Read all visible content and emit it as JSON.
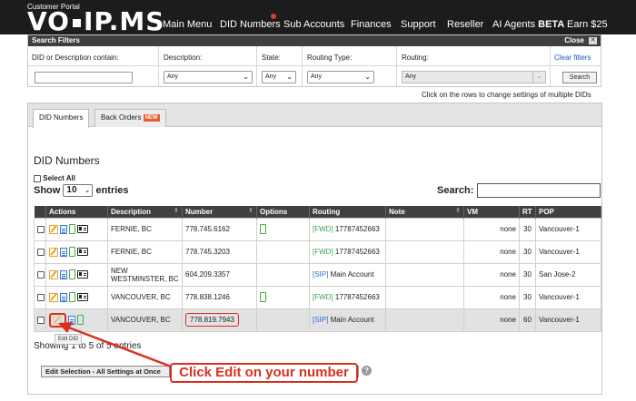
{
  "header": {
    "portal_label": "Customer Portal",
    "logo_left": "VO",
    "logo_right": "IP.MS",
    "nav": [
      {
        "label": "Main Menu"
      },
      {
        "label": "DID Numbers"
      },
      {
        "label": "Sub Accounts"
      },
      {
        "label": "Finances"
      },
      {
        "label": "Support"
      },
      {
        "label": "Reseller"
      },
      {
        "label": "AI Agents",
        "suffix": "BETA"
      },
      {
        "label": "Earn $25"
      }
    ],
    "notification_color": "#e53935"
  },
  "filters": {
    "title": "Search Filters",
    "close_label": "Close",
    "columns": {
      "description_contains": "DID or Description contain:",
      "description": "Description:",
      "state": "State:",
      "routing_type": "Routing Type:",
      "routing": "Routing:"
    },
    "values": {
      "description_contains": "",
      "description": "Any",
      "state": "Any",
      "routing_type": "Any",
      "routing": "Any"
    },
    "clear_label": "Clear filters",
    "search_label": "Search"
  },
  "hint": "Click on the rows to change settings of multiple DIDs",
  "tabs": [
    {
      "label": "DID Numbers",
      "active": true
    },
    {
      "label": "Back Orders",
      "badge": "NEW"
    }
  ],
  "section_title": "DID Numbers",
  "select_all_label": "Select All",
  "show_label": "Show",
  "entries_value": "10",
  "entries_label": "entries",
  "search_label": "Search:",
  "table": {
    "headers": [
      "Actions",
      "Description",
      "Number",
      "Options",
      "Routing",
      "Note",
      "VM",
      "RT",
      "POP"
    ],
    "rows": [
      {
        "description": "FERNIE, BC",
        "number": "778.745.6162",
        "has_option": true,
        "routing_tag": "[FWD]",
        "routing_value": "17787452663",
        "note": "",
        "vm": "none",
        "rt": "30",
        "pop": "Vancouver-1"
      },
      {
        "description": "FERNIE, BC",
        "number": "778.745.3203",
        "has_option": false,
        "routing_tag": "[FWD]",
        "routing_value": "17787452663",
        "note": "",
        "vm": "none",
        "rt": "30",
        "pop": "Vancouver-1"
      },
      {
        "description": "NEW WESTMINSTER, BC",
        "number": "604.209.3357",
        "has_option": false,
        "routing_tag": "[SIP]",
        "routing_value": "Main Account",
        "note": "",
        "vm": "none",
        "rt": "30",
        "pop": "San Jose-2"
      },
      {
        "description": "VANCOUVER, BC",
        "number": "778.838.1246",
        "has_option": true,
        "routing_tag": "[FWD]",
        "routing_value": "17787452663",
        "note": "",
        "vm": "none",
        "rt": "30",
        "pop": "Vancouver-1"
      },
      {
        "description": "VANCOUVER, BC",
        "number": "778.819.7943",
        "has_option": false,
        "routing_tag": "[SIP]",
        "routing_value": "Main Account",
        "note": "",
        "vm": "none",
        "rt": "60",
        "pop": "Vancouver-1",
        "highlighted": true
      }
    ]
  },
  "showing_text": "Showing 1 to 5 of 5 entries",
  "tooltip": "Edit DID",
  "edit_selection_label": "Edit Selection - All Settings at Once",
  "help_glyph": "?",
  "callout": "Click Edit on your number",
  "colors": {
    "annotation": "#d83020",
    "fwd": "#3fa34d",
    "sip": "#2f6fd0",
    "header_bg": "#1c1c1c"
  }
}
